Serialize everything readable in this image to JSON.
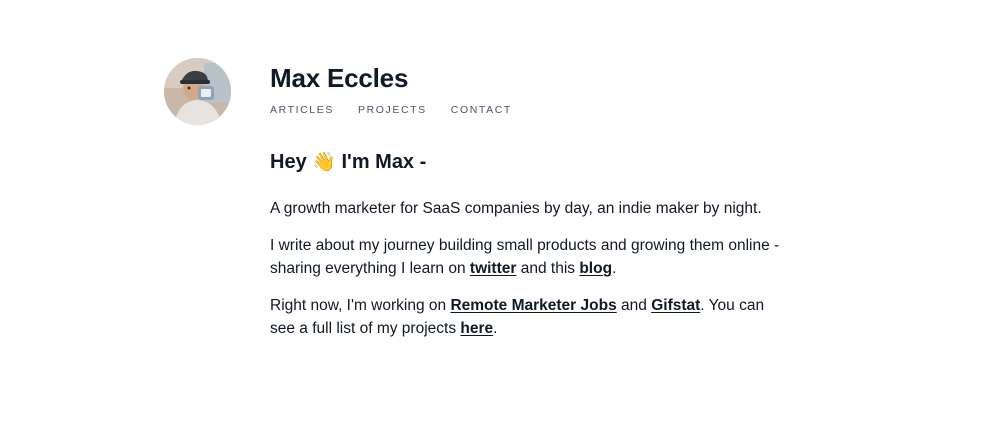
{
  "header": {
    "name": "Max Eccles",
    "nav": [
      {
        "label": "ARTICLES"
      },
      {
        "label": "PROJECTS"
      },
      {
        "label": "CONTACT"
      }
    ]
  },
  "intro": {
    "heading_start": "Hey",
    "heading_emoji": "👋",
    "heading_end": "I'm Max -",
    "p1": "A growth marketer for SaaS companies by day, an indie maker by night.",
    "p2_before": "I write about my journey building small products and growing them online - sharing everything I learn on",
    "p2_link1": "twitter",
    "p2_mid": "and this",
    "p2_link2": "blog",
    "p2_end": ".",
    "p3_before": "Right now, I'm working on",
    "p3_link1": "Remote Marketer Jobs",
    "p3_mid1": "and",
    "p3_link2": "Gifstat",
    "p3_mid2": ". You can see a full list of my projects",
    "p3_link3": "here",
    "p3_end": "."
  },
  "colors": {
    "text": "#111827",
    "nav_text": "#4b5563",
    "background": "#ffffff"
  },
  "icons": {
    "avatar": "profile-photo",
    "wave": "waving-hand"
  }
}
